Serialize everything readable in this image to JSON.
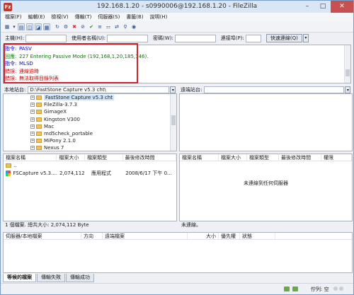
{
  "window": {
    "title": "192.168.1.20 - s0990006@192.168.1.20 - FileZilla",
    "app_icon_letter": "Fz"
  },
  "menu": [
    "檔案(F)",
    "編輯(E)",
    "檢視(V)",
    "傳輸(T)",
    "伺服器(S)",
    "書籤(B)",
    "說明(H)"
  ],
  "quickconnect": {
    "host_label": "主機(H):",
    "user_label": "使用者名稱(U):",
    "pass_label": "密碼(W):",
    "port_label": "連接埠(P):",
    "button": "快速連線(Q)"
  },
  "log": [
    {
      "tag": "指令:",
      "text": "PASV",
      "tag_color": "#0000c8",
      "text_color": "#0000c8"
    },
    {
      "tag": "回應:",
      "text": "227 Entering Passive Mode (192,168,1,20,185,146).",
      "tag_color": "#008000",
      "text_color": "#008000"
    },
    {
      "tag": "指令:",
      "text": "MLSD",
      "tag_color": "#0000c8",
      "text_color": "#0000c8"
    },
    {
      "tag": "錯誤:",
      "text": "連線逾時",
      "tag_color": "#d00000",
      "text_color": "#d00000"
    },
    {
      "tag": "錯誤:",
      "text": "無法取得目錄列表",
      "tag_color": "#d00000",
      "text_color": "#d00000"
    }
  ],
  "local_site": {
    "label": "本地站台:",
    "path": "D:\\FastStone Capture v5.3 cht\\"
  },
  "remote_site": {
    "label": "遠端站台:",
    "path": ""
  },
  "tree": [
    {
      "name": "FastStone Capture v5.3 cht",
      "selected": true
    },
    {
      "name": "FileZilla-3.7.3"
    },
    {
      "name": "GimageX"
    },
    {
      "name": "Kingston V300"
    },
    {
      "name": "Mac"
    },
    {
      "name": "md5check_portable"
    },
    {
      "name": "MiPony 2.1.0"
    },
    {
      "name": "Nexus 7"
    }
  ],
  "local_list": {
    "headers": [
      "檔案名稱",
      "檔案大小",
      "檔案類型",
      "最後修改時間"
    ],
    "rows": [
      {
        "name": "..",
        "size": "",
        "type": "",
        "modified": ""
      },
      {
        "name": "FSCapture v5.3....",
        "size": "2,074,112",
        "type": "應用程式",
        "modified": "2008/6/17 下午 0..."
      }
    ]
  },
  "remote_list": {
    "headers": [
      "檔案名稱",
      "檔案大小",
      "檔案類型",
      "最後修改時間",
      "權限"
    ],
    "empty_text": "未連線到任何伺服器"
  },
  "local_status": "1 個檔案. 總共大小: 2,074,112 Byte",
  "remote_status": "未連線。",
  "queue": {
    "headers": [
      "伺服器/本地檔案",
      "方向",
      "遠端檔案",
      "大小",
      "優先權",
      "狀態"
    ],
    "tabs": [
      "等候的檔案",
      "傳輸失敗",
      "傳輸成功"
    ]
  },
  "statusbar": {
    "queue_label": "佇列: 空"
  }
}
